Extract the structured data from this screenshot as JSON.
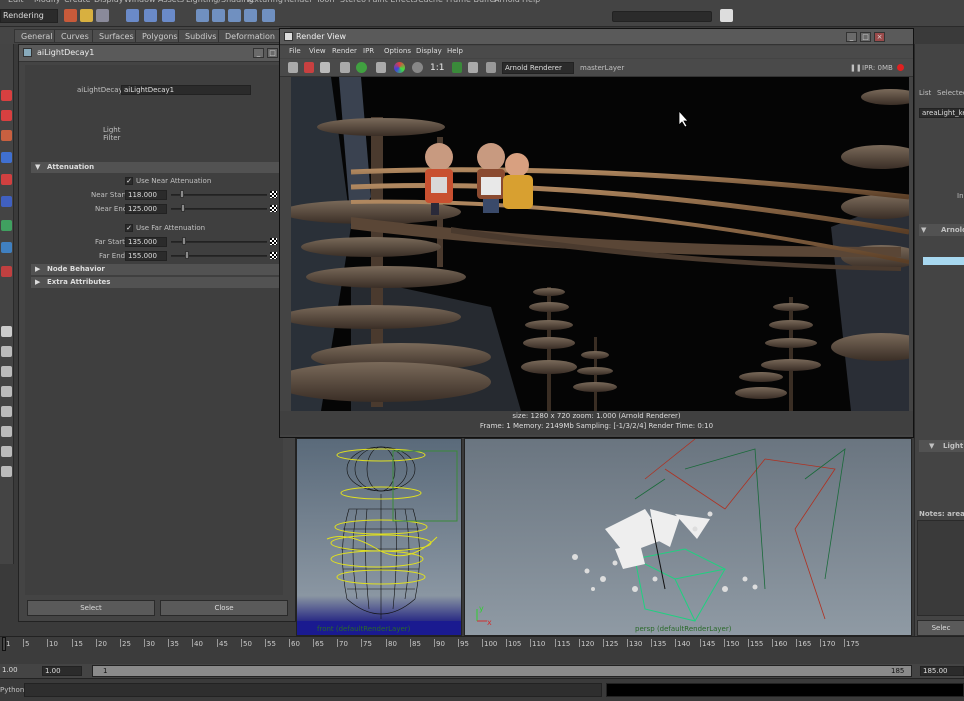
{
  "menubar": [
    "Edit",
    "Modify",
    "Create",
    "Display",
    "Window",
    "Assets",
    "Lighting/Shading",
    "Texturing",
    "Render",
    "Toon",
    "Stereo",
    "Paint Effects",
    "Cache",
    "Frame Buffer",
    "Arnold",
    "Help"
  ],
  "mode": "Rendering",
  "shelf_tabs": [
    "General",
    "Curves",
    "Surfaces",
    "Polygons",
    "Subdivs",
    "Deformation"
  ],
  "ae": {
    "title": "aiLightDecay1",
    "node_label": "aiLightDecay:",
    "node_value": "aiLightDecay1",
    "light_filter": "Light\nFilter",
    "attenuation": "Attenuation",
    "use_near": "Use Near Attenuation",
    "near_start_label": "Near Start",
    "near_start": "118.000",
    "near_end_label": "Near End",
    "near_end": "125.000",
    "use_far": "Use Far Attenuation",
    "far_start_label": "Far Start",
    "far_start": "135.000",
    "far_end_label": "Far End",
    "far_end": "155.000",
    "node_behavior": "Node Behavior",
    "extra_attributes": "Extra Attributes",
    "select_btn": "Select",
    "close_btn": "Close"
  },
  "render_view": {
    "title": "Render View",
    "menu": [
      "File",
      "View",
      "Render",
      "IPR",
      "Options",
      "Display",
      "Help"
    ],
    "ratio": "1:1",
    "renderer": "Arnold Renderer",
    "layer": "masterLayer",
    "ipr": "IPR: 0MB",
    "status_line1": "size: 1280 x 720  zoom: 1.000     (Arnold Renderer)",
    "status_line2": "Frame: 1     Memory: 2149Mb     Sampling: [-1/3/2/4]     Render Time: 0:10"
  },
  "right_panel": {
    "list": "List",
    "selected": "Selected",
    "node": "areaLight_key",
    "arnold": "Arnold",
    "light_f": "Light F",
    "notes": "Notes: areaL",
    "select": "Selec",
    "in": "In"
  },
  "viewports": {
    "front_caption": "front (defaultRenderLayer)",
    "persp_caption": "persp (defaultRenderLayer)"
  },
  "timeline": {
    "ticks": [
      "1",
      "5",
      "10",
      "15",
      "20",
      "25",
      "30",
      "35",
      "40",
      "45",
      "50",
      "55",
      "60",
      "65",
      "70",
      "75",
      "80",
      "85",
      "90",
      "95",
      "100",
      "105",
      "110",
      "115",
      "120",
      "125",
      "130",
      "135",
      "140",
      "145",
      "150",
      "155",
      "160",
      "165",
      "170",
      "175"
    ],
    "start": "1.00",
    "start2": "1.00",
    "range_start": "1",
    "range_end": "185",
    "end": "185.00",
    "end2": "185.00"
  },
  "cmdline": {
    "label": "Python"
  },
  "colors": {
    "accent_blue": "#a8d8f0",
    "wire_yellow": "#e0e020",
    "render_bg": "#050505"
  }
}
